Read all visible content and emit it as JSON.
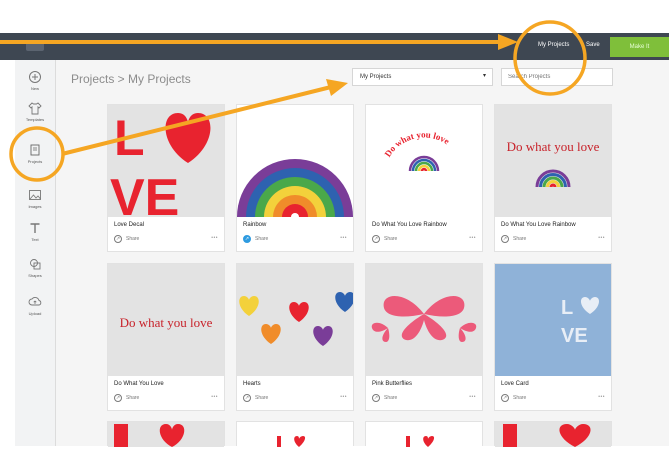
{
  "header": {
    "my_projects_label": "My Projects",
    "save_label": "Save",
    "make_it_label": "Make It"
  },
  "sidebar": {
    "items": [
      {
        "label": "New",
        "icon": "plus-circle-icon"
      },
      {
        "label": "Templates",
        "icon": "shirt-icon"
      },
      {
        "label": "Projects",
        "icon": "projects-icon"
      },
      {
        "label": "Images",
        "icon": "image-icon"
      },
      {
        "label": "Text",
        "icon": "text-icon"
      },
      {
        "label": "Shapes",
        "icon": "shapes-icon"
      },
      {
        "label": "Upload",
        "icon": "upload-icon"
      }
    ]
  },
  "breadcrumb": {
    "text": "Projects > My Projects"
  },
  "filter": {
    "selected": "My Projects"
  },
  "search": {
    "placeholder": "Search Projects"
  },
  "projects": [
    {
      "title": "Love Decal",
      "share": "Share",
      "more": "•••"
    },
    {
      "title": "Rainbow",
      "share": "Share",
      "more": "•••"
    },
    {
      "title": "Do What You Love Rainbow",
      "share": "Share",
      "more": "•••"
    },
    {
      "title": "Do What You Love Rainbow",
      "share": "Share",
      "more": "•••"
    },
    {
      "title": "Do What You Love",
      "share": "Share",
      "more": "•••"
    },
    {
      "title": "Hearts",
      "share": "Share",
      "more": "•••"
    },
    {
      "title": "Pink Butterflies",
      "share": "Share",
      "more": "•••"
    },
    {
      "title": "Love Card",
      "share": "Share",
      "more": "•••"
    }
  ],
  "artwork_text": {
    "arc_text": "Do what you love",
    "banner_text": "Do what you love",
    "card_text_l": "L",
    "card_text_ve": "VE",
    "decal_l": "L",
    "decal_ve": "VE"
  },
  "colors": {
    "topbar": "#3e4752",
    "make_it_green": "#7fbf3a",
    "love_red": "#e8232f",
    "annotation_orange": "#f5a623"
  }
}
